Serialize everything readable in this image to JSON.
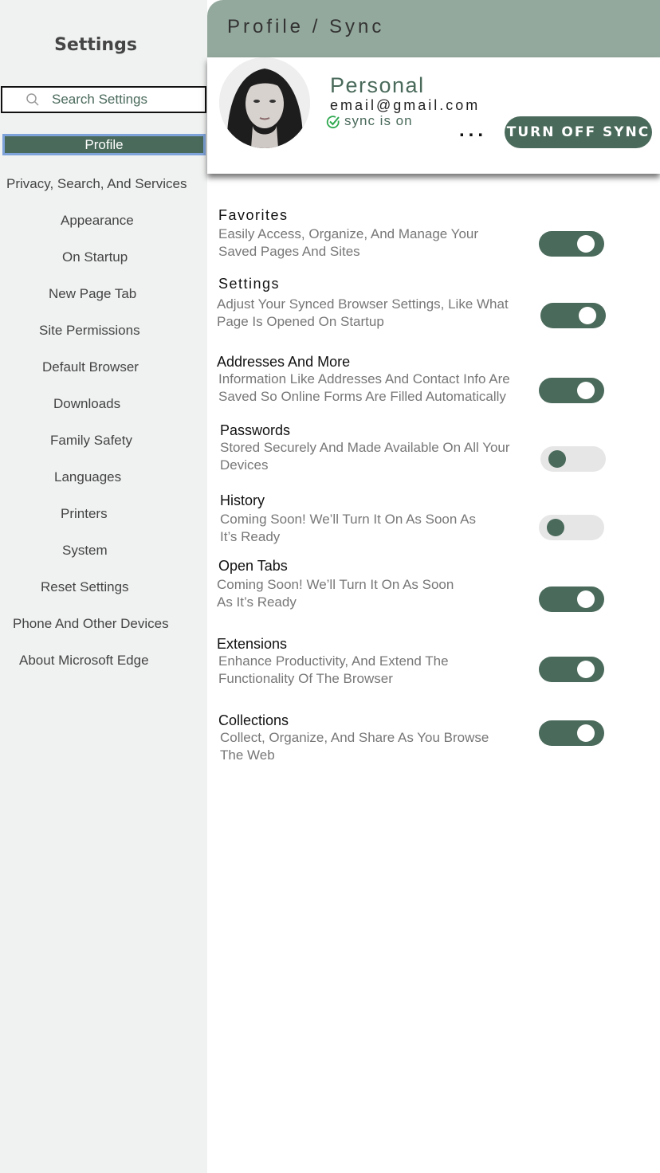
{
  "sidebar": {
    "title": "Settings",
    "search_placeholder": "Search Settings",
    "active_item": "Profile",
    "items": [
      "Privacy, Search, And Services",
      "Appearance",
      "On Startup",
      "New Page Tab",
      "Site Permissions",
      "Default Browser",
      "Downloads",
      "Family Safety",
      "Languages",
      "Printers",
      "System",
      "Reset Settings",
      "Phone And Other Devices",
      "About Microsoft Edge"
    ]
  },
  "header": {
    "title": "Profile / Sync"
  },
  "profile": {
    "name": "Personal",
    "email": "email@gmail.com",
    "sync_status": "sync is on",
    "more_label": "...",
    "turn_off_label": "TURN OFF SYNC"
  },
  "sync_items": [
    {
      "title": "Favorites",
      "desc1": "Easily Access, Organize, And Manage Your",
      "desc2": "Saved Pages And Sites",
      "enabled": true
    },
    {
      "title": "Settings",
      "desc1": "Adjust Your Synced Browser Settings, Like What",
      "desc2": "Page Is Opened On Startup",
      "enabled": true
    },
    {
      "title": "Addresses And More",
      "desc1": "Information Like Addresses And Contact Info Are",
      "desc2": "Saved So Online Forms Are Filled Automatically",
      "enabled": true
    },
    {
      "title": "Passwords",
      "desc1": "Stored Securely And Made Available On All Your",
      "desc2": "Devices",
      "enabled": false
    },
    {
      "title": "History",
      "desc1": "Coming Soon! We’ll Turn It On As Soon As",
      "desc2": "It’s Ready",
      "enabled": false
    },
    {
      "title": "Open Tabs",
      "desc1": "Coming Soon! We’ll Turn It  On As Soon",
      "desc2": "As It’s Ready",
      "enabled": true
    },
    {
      "title": "Extensions",
      "desc1": "Enhance Productivity, And Extend The",
      "desc2": "Functionality Of The Browser",
      "enabled": true
    },
    {
      "title": "Collections",
      "desc1": "Collect, Organize, And Share As You Browse",
      "desc2": "The Web",
      "enabled": true
    }
  ],
  "colors": {
    "accent": "#4a6a5b",
    "header": "#94a99d",
    "sidebar": "#f0f2f1"
  }
}
